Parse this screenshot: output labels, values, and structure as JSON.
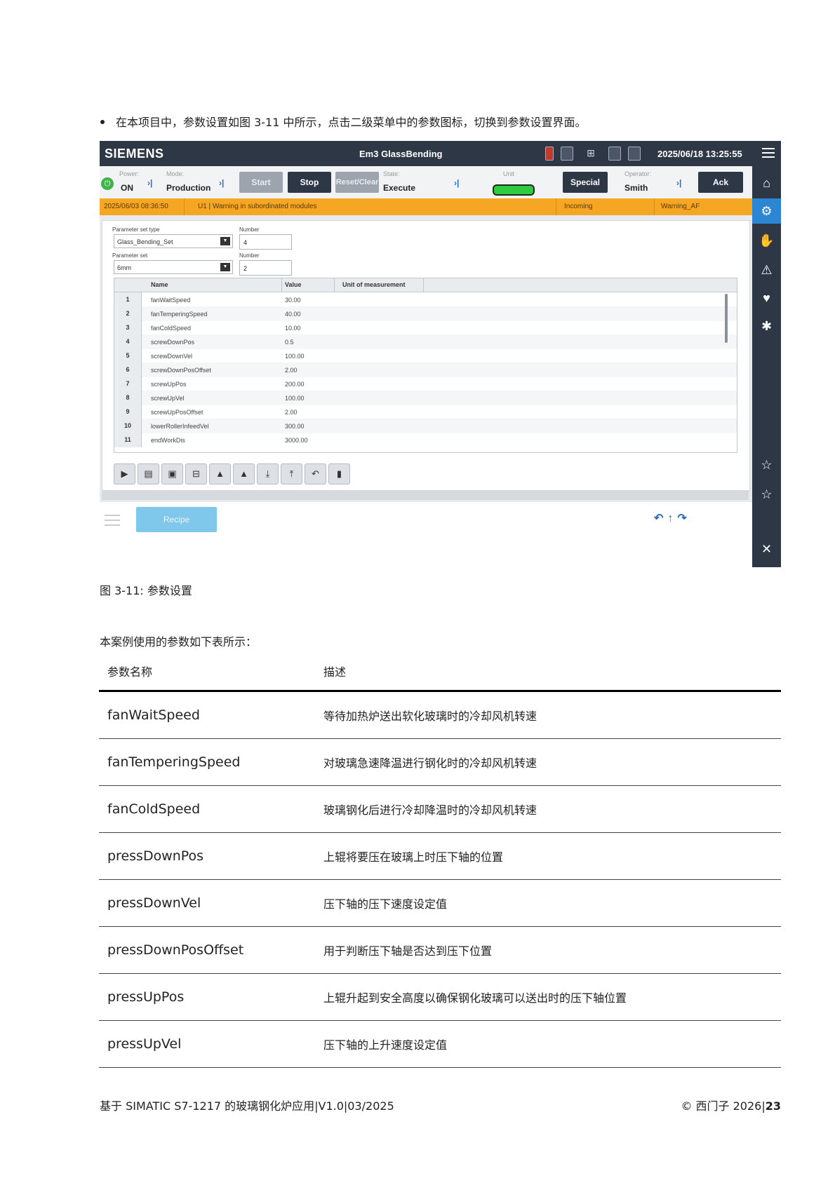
{
  "intro_bullet": "在本项目中，参数设置如图 3-11 中所示，点击二级菜单中的参数图标，切换到参数设置界面。",
  "hmi": {
    "brand": "SIEMENS",
    "title": "Em3 GlassBending",
    "datetime": "2025/06/18  13:25:55",
    "status": {
      "power_label": "Power:",
      "power_value": "ON",
      "mode_label": "Mode:",
      "mode_value": "Production",
      "start": "Start",
      "stop": "Stop",
      "reset": "Reset/Clear",
      "state_label": "State:",
      "state_value": "Execute",
      "unit_label": "Unit",
      "special": "Special",
      "operator_label": "Operator:",
      "operator_value": "Smith",
      "ack": "Ack"
    },
    "alarm": {
      "time": "2025/06/03 08:36:50",
      "message": "U1 | Warning in subordinated modules",
      "state": "Incoming",
      "class": "Warning_AF"
    },
    "params": {
      "set_type_label": "Parameter set type",
      "set_type_value": "Glass_Bending_Set",
      "number_label_1": "Number",
      "number_value_1": "4",
      "set_label": "Parameter set",
      "set_value": "6mm",
      "number_label_2": "Number",
      "number_value_2": "2"
    },
    "grid": {
      "headers": [
        "Name",
        "Value",
        "Unit of measurement"
      ],
      "rows": [
        {
          "idx": "1",
          "name": "fanWaitSpeed",
          "value": "30.00"
        },
        {
          "idx": "2",
          "name": "fanTemperingSpeed",
          "value": "40.00"
        },
        {
          "idx": "3",
          "name": "fanColdSpeed",
          "value": "10.00"
        },
        {
          "idx": "4",
          "name": "screwDownPos",
          "value": "0.5"
        },
        {
          "idx": "5",
          "name": "screwDownVel",
          "value": "100.00"
        },
        {
          "idx": "6",
          "name": "screwDownPosOffset",
          "value": "2.00"
        },
        {
          "idx": "7",
          "name": "screwUpPos",
          "value": "200.00"
        },
        {
          "idx": "8",
          "name": "screwUpVel",
          "value": "100.00"
        },
        {
          "idx": "9",
          "name": "screwUpPosOffset",
          "value": "2.00"
        },
        {
          "idx": "10",
          "name": "lowerRollerInfeedVel",
          "value": "300.00"
        },
        {
          "idx": "11",
          "name": "endWorkDis",
          "value": "3000.00"
        }
      ]
    },
    "nav": {
      "recipe": "Recipe"
    }
  },
  "caption": "图 3-11: 参数设置",
  "table_intro": "本案例使用的参数如下表所示：",
  "table": {
    "headers": [
      "参数名称",
      "描述"
    ],
    "rows": [
      {
        "name": "fanWaitSpeed",
        "desc": "等待加热炉送出软化玻璃时的冷却风机转速"
      },
      {
        "name": "fanTemperingSpeed",
        "desc": "对玻璃急速降温进行钢化时的冷却风机转速"
      },
      {
        "name": "fanColdSpeed",
        "desc": "玻璃钢化后进行冷却降温时的冷却风机转速"
      },
      {
        "name": "pressDownPos",
        "desc": "上辊将要压在玻璃上时压下轴的位置"
      },
      {
        "name": "pressDownVel",
        "desc": "压下轴的压下速度设定值"
      },
      {
        "name": "pressDownPosOffset",
        "desc": "用于判断压下轴是否达到压下位置"
      },
      {
        "name": "pressUpPos",
        "desc": "上辊升起到安全高度以确保钢化玻璃可以送出时的压下轴位置"
      },
      {
        "name": "pressUpVel",
        "desc": "压下轴的上升速度设定值"
      }
    ]
  },
  "footer": {
    "left": "基于 SIMATIC  S7-1217 的玻璃钢化炉应用|V1.0|03/2025",
    "right_prefix": "© 西门子 2026|",
    "page": "23"
  }
}
